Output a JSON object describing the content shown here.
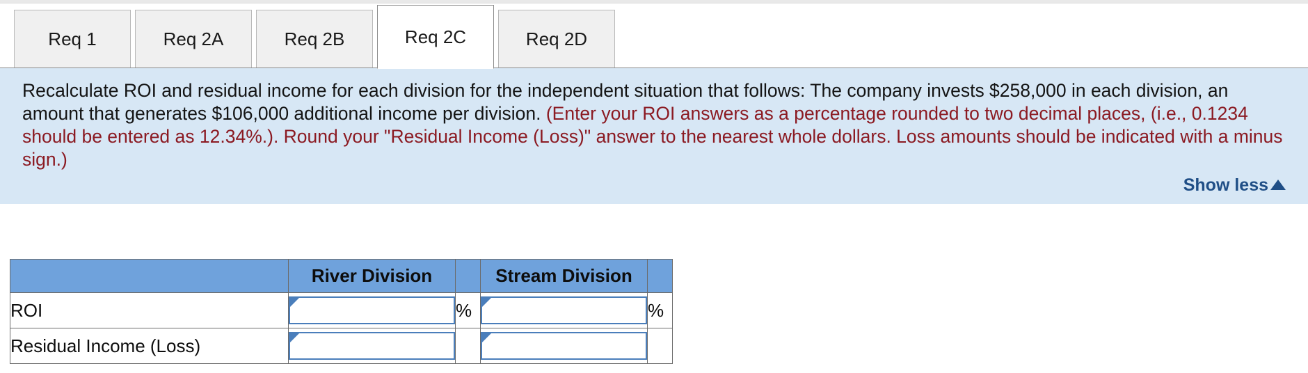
{
  "tabs": [
    {
      "label": "Req 1",
      "active": false
    },
    {
      "label": "Req 2A",
      "active": false
    },
    {
      "label": "Req 2B",
      "active": false
    },
    {
      "label": "Req 2C",
      "active": true
    },
    {
      "label": "Req 2D",
      "active": false
    }
  ],
  "instructions": {
    "black_text": "Recalculate ROI and residual income for each division for the independent situation that follows: The company invests $258,000 in each division, an amount that generates $106,000 additional income per division.",
    "red_text": "(Enter your ROI answers as a percentage rounded to two decimal places, (i.e., 0.1234 should be entered as 12.34%.). Round your \"Residual Income (Loss)\" answer to the nearest whole dollars. Loss amounts should be indicated with a minus sign.)",
    "show_less_label": "Show less",
    "panel_color": "#d7e7f5",
    "red_color": "#8b1a22",
    "link_color": "#1f4e86"
  },
  "table": {
    "header": {
      "blank": "",
      "columns": [
        "River Division",
        "Stream Division"
      ],
      "header_color": "#6fa2dc"
    },
    "rows": [
      {
        "label": "ROI",
        "cells": [
          {
            "value": "",
            "placeholder": "",
            "suffix": "%"
          },
          {
            "value": "",
            "placeholder": "",
            "suffix": "%"
          }
        ]
      },
      {
        "label": "Residual Income (Loss)",
        "cells": [
          {
            "value": "",
            "placeholder": "",
            "suffix": ""
          },
          {
            "value": "",
            "placeholder": "",
            "suffix": ""
          }
        ]
      }
    ]
  }
}
